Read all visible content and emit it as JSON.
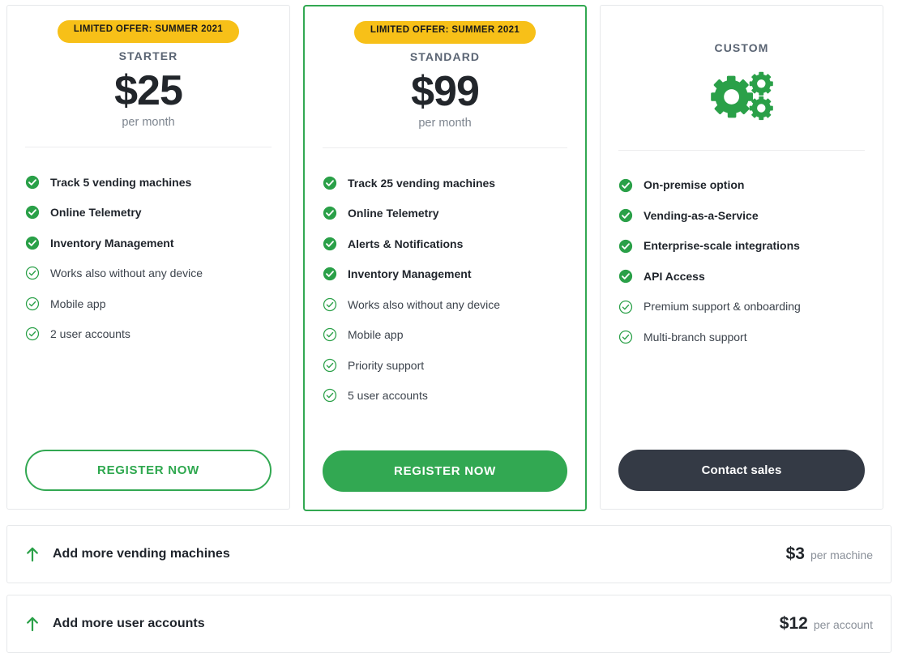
{
  "colors": {
    "green": "#32a852",
    "yellow": "#f7c018",
    "dark": "#343a45",
    "text": "#22262b",
    "muted": "#7d858f"
  },
  "plans": [
    {
      "badge": "LIMITED OFFER: SUMMER 2021",
      "name": "STARTER",
      "price": "$25",
      "period": "per month",
      "features": [
        {
          "label": "Track 5 vending machines",
          "style": "included"
        },
        {
          "label": "Online Telemetry",
          "style": "included"
        },
        {
          "label": "Inventory Management",
          "style": "included"
        },
        {
          "label": "Works also without any device",
          "style": "plain"
        },
        {
          "label": "Mobile app",
          "style": "plain"
        },
        {
          "label": "2 user accounts",
          "style": "plain"
        }
      ],
      "cta": "REGISTER NOW"
    },
    {
      "badge": "LIMITED OFFER: SUMMER 2021",
      "name": "STANDARD",
      "price": "$99",
      "period": "per month",
      "features": [
        {
          "label": "Track 25 vending machines",
          "style": "included"
        },
        {
          "label": "Online Telemetry",
          "style": "included"
        },
        {
          "label": "Alerts & Notifications",
          "style": "included"
        },
        {
          "label": "Inventory Management",
          "style": "included"
        },
        {
          "label": "Works also without any device",
          "style": "plain"
        },
        {
          "label": "Mobile app",
          "style": "plain"
        },
        {
          "label": "Priority support",
          "style": "plain"
        },
        {
          "label": "5 user accounts",
          "style": "plain"
        }
      ],
      "cta": "REGISTER NOW"
    },
    {
      "name": "CUSTOM",
      "icon": "gears-icon",
      "features": [
        {
          "label": "On-premise option",
          "style": "included"
        },
        {
          "label": "Vending-as-a-Service",
          "style": "included"
        },
        {
          "label": "Enterprise-scale integrations",
          "style": "included"
        },
        {
          "label": "API Access",
          "style": "included"
        },
        {
          "label": "Premium support & onboarding",
          "style": "plain"
        },
        {
          "label": "Multi-branch support",
          "style": "plain"
        }
      ],
      "cta": "Contact sales"
    }
  ],
  "addons": [
    {
      "icon": "arrow-up-icon",
      "title": "Add more vending machines",
      "price": "$3",
      "unit": "per machine"
    },
    {
      "icon": "arrow-up-icon",
      "title": "Add more user accounts",
      "price": "$12",
      "unit": "per account"
    }
  ]
}
